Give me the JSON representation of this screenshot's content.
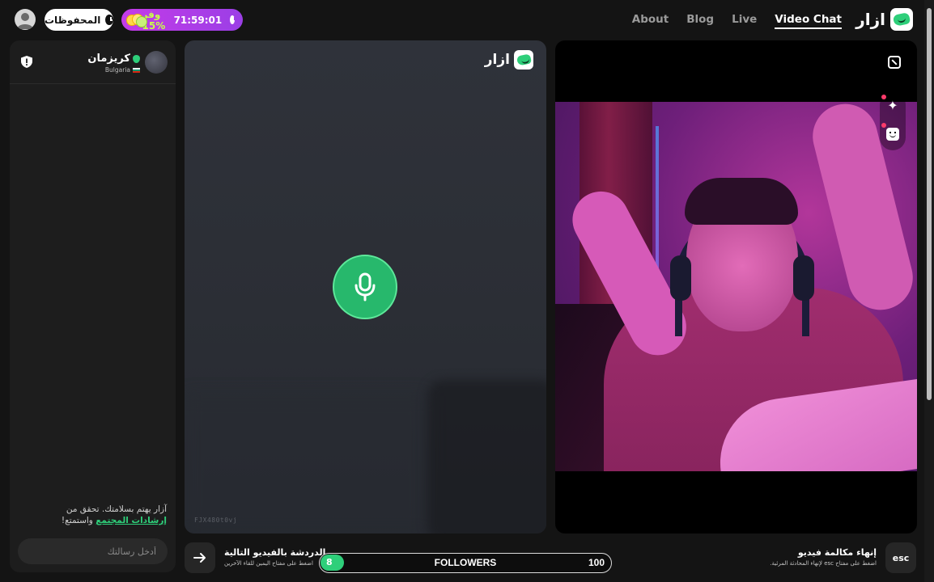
{
  "header": {
    "saved_label": "المحفوظات",
    "promo": {
      "discount": "وفر 15%",
      "timer": "71:59:01"
    },
    "nav": [
      "About",
      "Blog",
      "Live",
      "Video Chat"
    ],
    "nav_active": "Video Chat",
    "logo_text": "ازار"
  },
  "chat": {
    "partner_name": "كريزمان",
    "partner_country": "Bulgaria",
    "safety_text": "آزار يهتم بسلامتك. تحقق من",
    "safety_link": "إرشادات المجتمع",
    "safety_suffix": "واستمتع!",
    "input_placeholder": "أدخل رسالتك"
  },
  "stranger_video": {
    "logo_text": "ازار",
    "session_id": "FJX480t0vj"
  },
  "bottom": {
    "next_title": "الدردشة بالفيديو التالية",
    "next_sub": "اضغط على مفتاح اليمين للقاء الآخرين",
    "followers_label": "FOLLOWERS",
    "followers_current": "8",
    "followers_goal": "100",
    "followers_progress": 0.08,
    "end_title": "إنهاء مكالمة فيديو",
    "end_sub": "اضغط على مفتاح esc لإنهاء المحادثة المرئية.",
    "esc_label": "esc"
  },
  "colors": {
    "accent": "#2ecf7a",
    "promo": "#c43be8",
    "background": "#141414"
  }
}
